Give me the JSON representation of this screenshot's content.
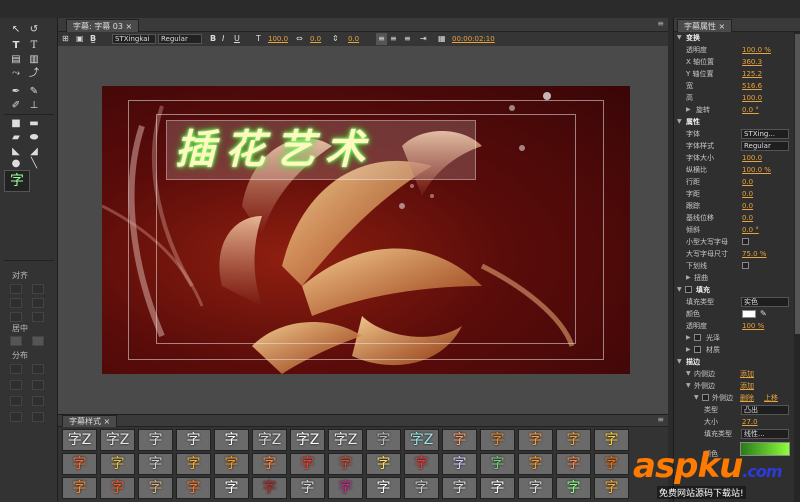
{
  "window": {
    "top_strip": ""
  },
  "toolbox": {
    "align_label": "对齐",
    "center_label": "居中",
    "distribute_label": "分布",
    "preset_glyph": "字"
  },
  "title_panel": {
    "tab_label": "字幕: 字幕 03",
    "toolbar": {
      "font_family": "STXingkai",
      "font_style": "Regular",
      "font_size": "100.0",
      "kerning": "0.0",
      "leading": "0.0",
      "timecode": "00:00:02:10"
    },
    "title_text": "插花艺术"
  },
  "styles_panel": {
    "tab_label": "字幕样式",
    "swatches": [
      [
        "字Z",
        "字Z",
        "字",
        "字",
        "字",
        "字Z",
        "字Z",
        "字Z",
        "字",
        "字Z",
        "字",
        "字",
        "字",
        "字",
        "字"
      ],
      [
        "字",
        "字",
        "字",
        "字",
        "字",
        "字",
        "字",
        "字",
        "字",
        "字",
        "字",
        "字",
        "字",
        "字",
        "字"
      ],
      [
        "字",
        "字",
        "字",
        "字",
        "字",
        "字",
        "字",
        "字",
        "字",
        "字",
        "字",
        "字",
        "字",
        "字",
        "字"
      ]
    ],
    "swatch_colors": [
      [
        "#eeeeee",
        "#e6e6e6",
        "#dddddd",
        "#f0f0f0",
        "#ffffff",
        "#dddddd",
        "#ffffff",
        "#eeeeee",
        "#bbbbbb",
        "#9fe6e6",
        "#ff9a6a",
        "#e88a30",
        "#ff9a40",
        "#f0a040",
        "#ffcc33"
      ],
      [
        "#ff6a2a",
        "#e8c040",
        "#cfcfcf",
        "#ffb030",
        "#ff9a20",
        "#ff8a3a",
        "#ff3a2a",
        "#d84a2a",
        "#ffdd66",
        "#ff3333",
        "#d0d0ff",
        "#7ad07a",
        "#ff9a2a",
        "#ff8a4a",
        "#ff6a00"
      ],
      [
        "#ff8a30",
        "#ff5a20",
        "#d8b080",
        "#ff7a2a",
        "#ffffff",
        "#c02a2a",
        "#dddddd",
        "#d02a8a",
        "#ffffff",
        "#cccccc",
        "#e0e0e0",
        "#ffffff",
        "#dddddd",
        "#88ff88",
        "#ffaa33"
      ]
    ]
  },
  "properties": {
    "header": "字幕属性",
    "transform": {
      "title": "变换",
      "rows": [
        {
          "label": "透明度",
          "value": "100.0 %"
        },
        {
          "label": "X 轴位置",
          "value": "360.3"
        },
        {
          "label": "Y 轴位置",
          "value": "125.2"
        },
        {
          "label": "宽",
          "value": "516.6"
        },
        {
          "label": "高",
          "value": "100.0"
        },
        {
          "label": "旋转",
          "value": "0.0 °"
        }
      ]
    },
    "properties_section": {
      "title": "属性",
      "font": {
        "label": "字体",
        "value": "STXing..."
      },
      "font_style": {
        "label": "字体样式",
        "value": "Regular"
      },
      "rows": [
        {
          "label": "字体大小",
          "value": "100.0"
        },
        {
          "label": "纵横比",
          "value": "100.0 %"
        },
        {
          "label": "行距",
          "value": "0.0"
        },
        {
          "label": "字距",
          "value": "0.0"
        },
        {
          "label": "跟踪",
          "value": "0.0"
        },
        {
          "label": "基线位移",
          "value": "0.0"
        },
        {
          "label": "倾斜",
          "value": "0.0 °"
        }
      ],
      "small_caps": "小型大写字母",
      "small_caps_size": {
        "label": "大写字母尺寸",
        "value": "75.0 %"
      },
      "underline": "下划线",
      "distort": "扭曲"
    },
    "fill": {
      "title": "填充",
      "fill_type": {
        "label": "填充类型",
        "value": "实色"
      },
      "color": {
        "label": "颜色"
      },
      "opacity": {
        "label": "透明度",
        "value": "100 %"
      },
      "sheen": "光泽",
      "texture": "材质"
    },
    "stroke": {
      "title": "描边",
      "inner": {
        "label": "内侧边",
        "action": "添加"
      },
      "outer": {
        "label": "外侧边",
        "action": "添加"
      },
      "outer_item": {
        "label": "外侧边",
        "delete": "删除",
        "up": "上移"
      },
      "type": {
        "label": "类型",
        "value": "凸出"
      },
      "size": {
        "label": "大小",
        "value": "27.0"
      },
      "fill_type": {
        "label": "填充类型",
        "value": "线性..."
      },
      "color_label": "颜色"
    }
  },
  "watermark": {
    "logo_main": "aspku",
    "logo_tld": ".com",
    "subtitle": "免费网站源码下载站!"
  }
}
